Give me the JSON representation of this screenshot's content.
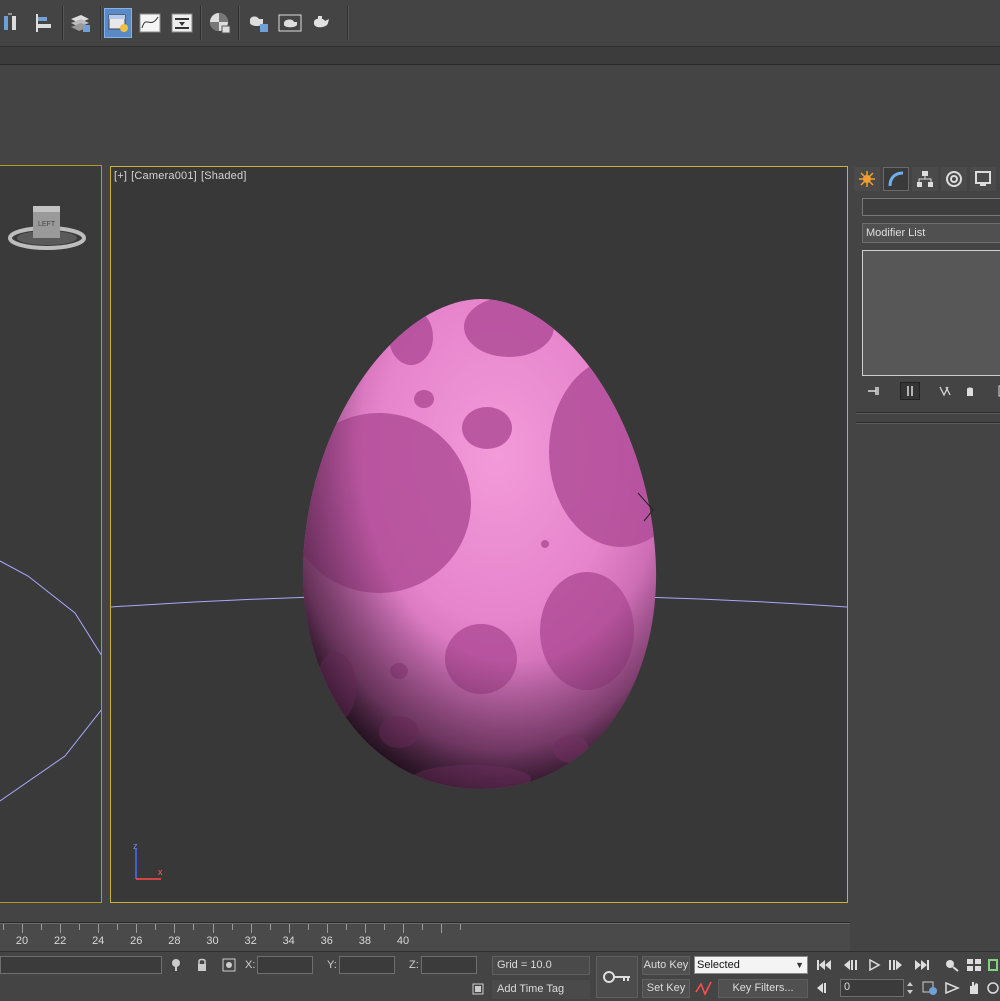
{
  "toolbar": {
    "icons": [
      "mirror-icon",
      "align-icon",
      "layer-manager-icon",
      "scene-explorer-icon",
      "curve-editor-icon",
      "schematic-view-icon",
      "material-editor-icon",
      "render-setup-icon",
      "rendered-frame-icon",
      "render-teapot-icon",
      "render-production-icon"
    ],
    "active": "scene-explorer-icon"
  },
  "left_viewport": {
    "view_cube_face": "LEFT"
  },
  "viewport": {
    "label_plus": "[+]",
    "label_camera": "[Camera001]",
    "label_shading": "[Shaded]",
    "axis_x": "x",
    "axis_z": "z",
    "object": "egg",
    "object_color": "#e07ec8",
    "spot_color": "#b04a96"
  },
  "command_panel": {
    "tabs": [
      "create-icon",
      "modify-icon",
      "hierarchy-icon",
      "motion-icon",
      "display-icon"
    ],
    "active_tab": "modify-icon",
    "name_value": "",
    "modifier_list": "Modifier List"
  },
  "ruler": {
    "ticks": [
      "20",
      "22",
      "24",
      "26",
      "28",
      "30",
      "32",
      "34",
      "36",
      "38",
      "40"
    ]
  },
  "status": {
    "x_label": "X:",
    "y_label": "Y:",
    "z_label": "Z:",
    "x_value": "",
    "y_value": "",
    "z_value": "",
    "grid": "Grid = 10.0",
    "add_time_tag": "Add Time Tag",
    "auto_key": "Auto Key",
    "set_key": "Set Key",
    "selected": "Selected",
    "key_filters": "Key Filters...",
    "frame_value": "0"
  },
  "colors": {
    "viewport_border": "#c9b23a",
    "grid_line": "#a8a8ff",
    "active_button": "#5a8ac6"
  }
}
